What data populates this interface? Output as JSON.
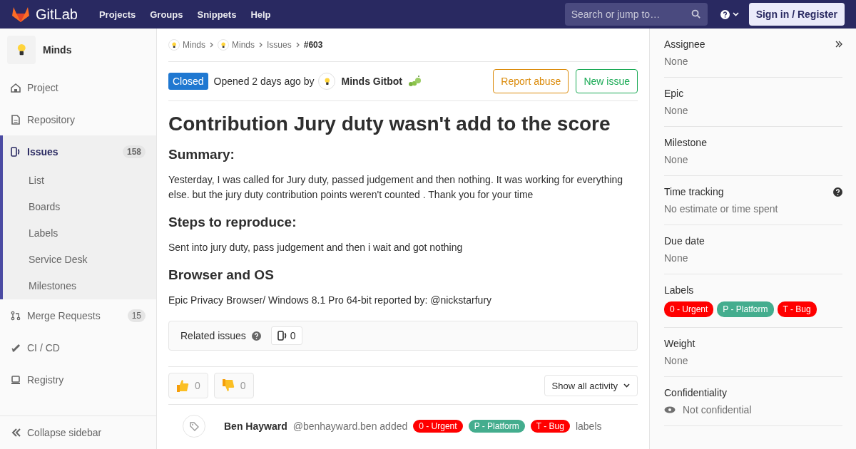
{
  "navbar": {
    "brand": "GitLab",
    "links": [
      "Projects",
      "Groups",
      "Snippets",
      "Help"
    ],
    "search": {
      "placeholder": "Search or jump to…"
    },
    "signin": "Sign in / Register"
  },
  "sidebar": {
    "project": "Minds",
    "items": [
      {
        "label": "Project",
        "selected": false
      },
      {
        "label": "Repository",
        "selected": false
      },
      {
        "label": "Issues",
        "selected": true,
        "count": "158",
        "children": [
          {
            "label": "List"
          },
          {
            "label": "Boards"
          },
          {
            "label": "Labels"
          },
          {
            "label": "Service Desk"
          },
          {
            "label": "Milestones"
          }
        ]
      },
      {
        "label": "Merge Requests",
        "selected": false,
        "count": "15"
      },
      {
        "label": "CI / CD",
        "selected": false
      },
      {
        "label": "Registry",
        "selected": false
      }
    ],
    "collapse": "Collapse sidebar"
  },
  "breadcrumbs": [
    "Minds",
    "Minds",
    "Issues",
    "#603"
  ],
  "issue": {
    "status": "Closed",
    "opened": "Opened 2 days ago by",
    "author": "Minds Gitbot",
    "actions": [
      "Report abuse",
      "New issue"
    ],
    "title": "Contribution Jury duty wasn't add to the score",
    "sections": [
      {
        "heading": "Summary:",
        "text": "Yesterday, I was called for Jury duty, passed judgement and then nothing. It was working for everything else. but the jury duty contribution points weren't counted . Thank you for your time"
      },
      {
        "heading": "Steps to reproduce:",
        "text": "Sent into jury duty, pass judgement and then i wait and got nothing"
      },
      {
        "heading": "Browser and OS",
        "text": "Epic Privacy Browser/ Windows 8.1 Pro 64-bit reported by: @nickstarfury"
      }
    ],
    "related": {
      "label": "Related issues",
      "count": "0"
    },
    "awards": [
      {
        "kind": "up",
        "count": "0"
      },
      {
        "kind": "down",
        "count": "0"
      }
    ],
    "activity_filter": "Show all activity",
    "note": {
      "author": "Ben Hayward",
      "handle": "@benhayward.ben added",
      "labels": [
        {
          "text": "0 - Urgent",
          "color": "#ff0000"
        },
        {
          "text": "P - Platform",
          "color": "#44ad8e"
        },
        {
          "text": "T - Bug",
          "color": "#ff0000"
        }
      ],
      "suffix": "labels"
    }
  },
  "right_sidebar": {
    "blocks": [
      {
        "title": "Assignee",
        "value": "None",
        "kind": "plain"
      },
      {
        "title": "Epic",
        "value": "None",
        "kind": "plain"
      },
      {
        "title": "Milestone",
        "value": "None",
        "kind": "plain"
      },
      {
        "title": "Time tracking",
        "value": "No estimate or time spent",
        "kind": "help"
      },
      {
        "title": "Due date",
        "value": "None",
        "kind": "plain"
      },
      {
        "title": "Labels",
        "kind": "labels",
        "labels": [
          {
            "text": "0 - Urgent",
            "color": "#ff0000"
          },
          {
            "text": "P - Platform",
            "color": "#44ad8e"
          },
          {
            "text": "T - Bug",
            "color": "#ff0000"
          }
        ]
      },
      {
        "title": "Weight",
        "value": "None",
        "kind": "plain"
      },
      {
        "title": "Confidentiality",
        "value": "Not confidential",
        "kind": "eye"
      }
    ]
  }
}
